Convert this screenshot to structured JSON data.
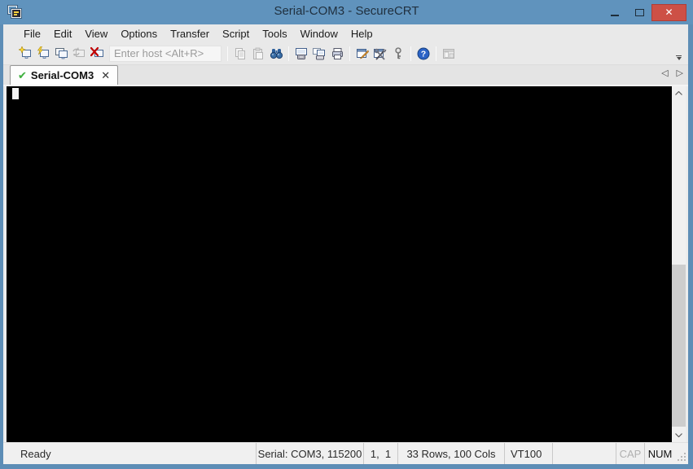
{
  "window": {
    "title": "Serial-COM3 - SecureCRT",
    "app_icon": "securecrt-terminal-windows",
    "controls": [
      "minimize",
      "maximize",
      "close"
    ],
    "close_glyph": "✕"
  },
  "colors": {
    "titlebar": "#6093bd",
    "window_border": "#5d8db6",
    "close_button": "#cd5046",
    "chrome_background": "#e9e9e9",
    "terminal_background": "#000000",
    "statusbar_background": "#f0f0f0",
    "tab_check_green": "#3daf3d",
    "find_icon_blue": "#2d5f9b",
    "help_icon_blue": "#2b63c6"
  },
  "menu": {
    "items": [
      "File",
      "Edit",
      "View",
      "Options",
      "Transfer",
      "Script",
      "Tools",
      "Window",
      "Help"
    ]
  },
  "toolbar": {
    "host_placeholder": "Enter host <Alt+R>",
    "host_value": "",
    "icons": [
      "connect",
      "quick-connect",
      "connect-in-tab",
      "reconnect",
      "disconnect",
      "copy",
      "paste",
      "find",
      "print-screen",
      "print-selection",
      "print",
      "session-options",
      "global-options",
      "key",
      "help",
      "session-manager"
    ],
    "disabled_icons": [
      "reconnect",
      "copy",
      "paste",
      "session-manager"
    ]
  },
  "tabbar": {
    "active_tab": {
      "label": "Serial-COM3",
      "status_icon": "connected-check",
      "check_glyph": "✔",
      "close_glyph": "✕"
    },
    "scroll_left_glyph": "◁",
    "scroll_right_glyph": "▷"
  },
  "terminal": {
    "content": "",
    "cursor_visible": true
  },
  "statusbar": {
    "ready": "Ready",
    "connection": "Serial: COM3, 115200",
    "cursor_position": "1,  1",
    "dimensions": "33 Rows, 100 Cols",
    "emulation": "VT100",
    "caps_lock": "CAP",
    "num_lock": "NUM"
  }
}
